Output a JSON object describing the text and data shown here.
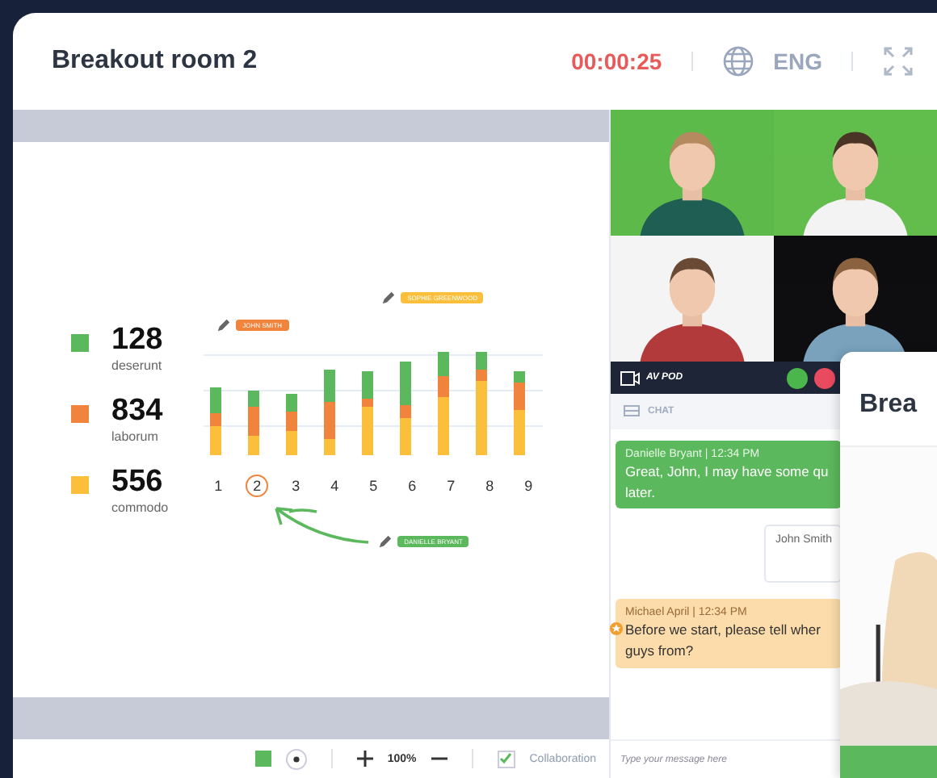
{
  "window": {
    "title": "Breakout room 2",
    "timer": "00:00:25",
    "language": "ENG"
  },
  "slide": {
    "legend": [
      {
        "value": "128",
        "label": "deserunt",
        "color": "#5cb85c"
      },
      {
        "value": "834",
        "label": "laborum",
        "color": "#f0843c"
      },
      {
        "value": "556",
        "label": "commodo",
        "color": "#fbbf3c"
      }
    ],
    "x_labels": [
      {
        "text": "1",
        "selected": false
      },
      {
        "text": "2",
        "selected": true
      },
      {
        "text": "3",
        "selected": false
      },
      {
        "text": "4",
        "selected": false
      },
      {
        "text": "5",
        "selected": false
      },
      {
        "text": "6",
        "selected": false
      },
      {
        "text": "7",
        "selected": false
      },
      {
        "text": "8",
        "selected": false
      },
      {
        "text": "9",
        "selected": false
      }
    ],
    "annotations": [
      {
        "name": "SOPHIE GREENWOOD",
        "color": "#fbbf3c"
      },
      {
        "name": "JOHN SMITH",
        "color": "#f0843c"
      },
      {
        "name": "DANIELLE BRYANT",
        "color": "#5cb85c"
      }
    ]
  },
  "toolbar": {
    "zoom": "100%",
    "collaboration": {
      "label": "Collaboration",
      "checked": true
    }
  },
  "video": {
    "bar_label": "AV POD"
  },
  "chat": {
    "title": "CHAT",
    "messages": [
      {
        "kind": "highlight",
        "meta": "Danielle Bryant  |  12:34 PM",
        "lines": [
          "Great, John, I may have some qu",
          "later."
        ]
      },
      {
        "kind": "own",
        "meta": "John Smith"
      },
      {
        "kind": "starred",
        "meta": "Michael April  |  12:34 PM",
        "lines": [
          "Before we start, please tell wher",
          "guys from?"
        ]
      }
    ],
    "placeholder": "Type your message here"
  },
  "overlay": {
    "title": "Brea"
  }
}
